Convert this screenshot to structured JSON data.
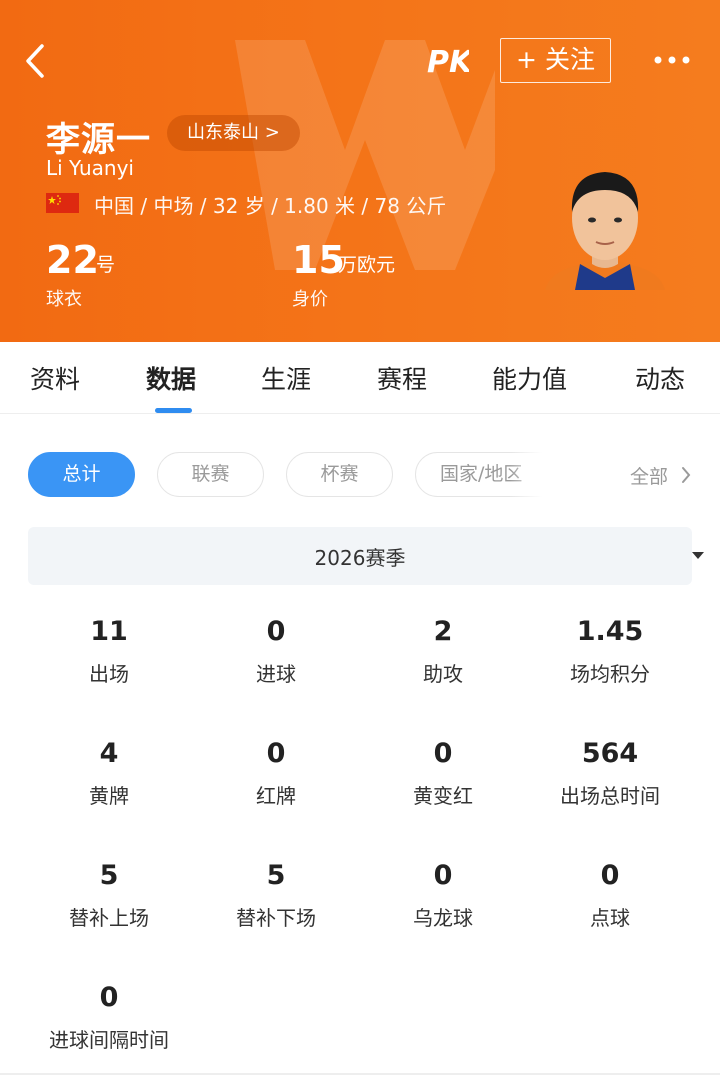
{
  "header": {
    "follow_label": "+ 关注",
    "logo_text": "PK",
    "name_cn": "李源一",
    "team": "山东泰山 >",
    "name_en": "Li Yuanyi",
    "info": "中国 / 中场 / 32 岁 / 1.80 米 / 78 公斤",
    "jersey_number": "22",
    "jersey_unit": "号",
    "jersey_label": "球衣",
    "value_number": "15",
    "value_unit": "万欧元",
    "value_label": "身价",
    "colors": {
      "primary": "#f26a12",
      "accent": "#3a95f5"
    }
  },
  "tabs": [
    {
      "label": "资料"
    },
    {
      "label": "数据",
      "active": true
    },
    {
      "label": "生涯"
    },
    {
      "label": "赛程"
    },
    {
      "label": "能力值"
    },
    {
      "label": "动态"
    }
  ],
  "filters": {
    "chips": [
      "总计",
      "联赛",
      "杯赛",
      "国家/地区"
    ],
    "active": "总计",
    "all_label": "全部"
  },
  "season": {
    "selected": "2026赛季"
  },
  "stats": [
    {
      "value": "11",
      "label": "出场"
    },
    {
      "value": "0",
      "label": "进球"
    },
    {
      "value": "2",
      "label": "助攻"
    },
    {
      "value": "1.45",
      "label": "场均积分"
    },
    {
      "value": "4",
      "label": "黄牌"
    },
    {
      "value": "0",
      "label": "红牌"
    },
    {
      "value": "0",
      "label": "黄变红"
    },
    {
      "value": "564",
      "label": "出场总时间"
    },
    {
      "value": "5",
      "label": "替补上场"
    },
    {
      "value": "5",
      "label": "替补下场"
    },
    {
      "value": "0",
      "label": "乌龙球"
    },
    {
      "value": "0",
      "label": "点球"
    },
    {
      "value": "0",
      "label": "进球间隔时间"
    }
  ]
}
